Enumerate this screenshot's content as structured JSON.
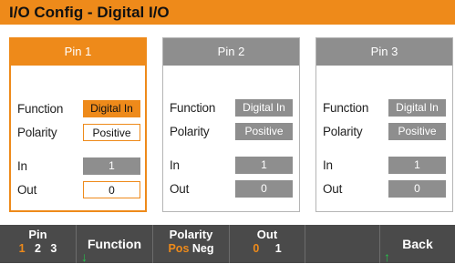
{
  "title": "I/O Config - Digital I/O",
  "pins": [
    {
      "header": "Pin 1",
      "function_label": "Function",
      "function_value": "Digital In",
      "polarity_label": "Polarity",
      "polarity_value": "Positive",
      "in_label": "In",
      "in_value": "1",
      "out_label": "Out",
      "out_value": "0",
      "active": true
    },
    {
      "header": "Pin 2",
      "function_label": "Function",
      "function_value": "Digital In",
      "polarity_label": "Polarity",
      "polarity_value": "Positive",
      "in_label": "In",
      "in_value": "1",
      "out_label": "Out",
      "out_value": "0",
      "active": false
    },
    {
      "header": "Pin 3",
      "function_label": "Function",
      "function_value": "Digital In",
      "polarity_label": "Polarity",
      "polarity_value": "Positive",
      "in_label": "In",
      "in_value": "1",
      "out_label": "Out",
      "out_value": "0",
      "active": false
    }
  ],
  "softkeys": {
    "pin": {
      "label": "Pin",
      "options": [
        "1",
        "2",
        "3"
      ]
    },
    "function": {
      "label": "Function"
    },
    "polarity": {
      "label": "Polarity",
      "options": [
        "Pos",
        "Neg"
      ]
    },
    "out": {
      "label": "Out",
      "options": [
        "0",
        "1"
      ]
    },
    "back": {
      "label": "Back"
    },
    "arrow_down": "↓",
    "arrow_up": "↑"
  },
  "colors": {
    "accent": "#ee8a1a",
    "inactive": "#8e8e8e",
    "softkey_bg": "#4a4a4a",
    "arrow": "#27c24c"
  }
}
